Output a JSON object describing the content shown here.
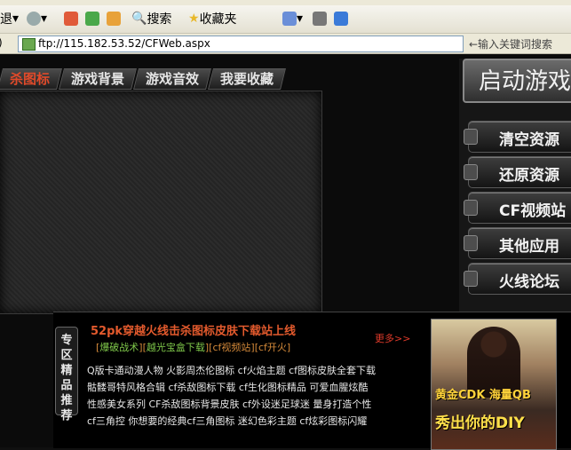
{
  "browser": {
    "address": "ftp://115.182.53.52/CFWeb.aspx",
    "search_hint": "←输入关键词搜索",
    "back_label": "退",
    "search_label": "搜索",
    "favorites_label": "收藏夹"
  },
  "tabs": [
    {
      "label": "杀图标",
      "active": true
    },
    {
      "label": "游戏背景",
      "active": false
    },
    {
      "label": "游戏音效",
      "active": false
    },
    {
      "label": "我要收藏",
      "active": false
    }
  ],
  "launch_label": "启动游戏",
  "side_buttons": [
    "清空资源",
    "还原资源",
    "CF视频站",
    "其他应用",
    "火线论坛"
  ],
  "bottom": {
    "vertical_label": "专区精品推荐",
    "headline": "52pk穿越火线击杀图标皮肤下载站上线",
    "links": [
      "[",
      "爆破战术",
      "][",
      "越光宝盒下载",
      "][",
      "cf视频站",
      "][",
      "cf开火",
      "]"
    ],
    "more": "更多>>",
    "tag_lines": [
      "Q版卡通动漫人物  火影周杰伦图标  cf火焰主题  cf图标皮肤全套下载",
      "骷髅哥特风格合辑  cf杀敌图标下载  cf生化图标精品  可爱血腥炫酷",
      "性感美女系列  CF杀敌图标背景皮肤  cf外设迷足球迷  量身打造个性",
      "cf三角控  你想要的经典cf三角图标  迷幻色彩主题  cf炫彩图标闪耀"
    ],
    "promo_line1": "黄金CDK 海量QB",
    "promo_line2": "秀出你的DIY"
  }
}
